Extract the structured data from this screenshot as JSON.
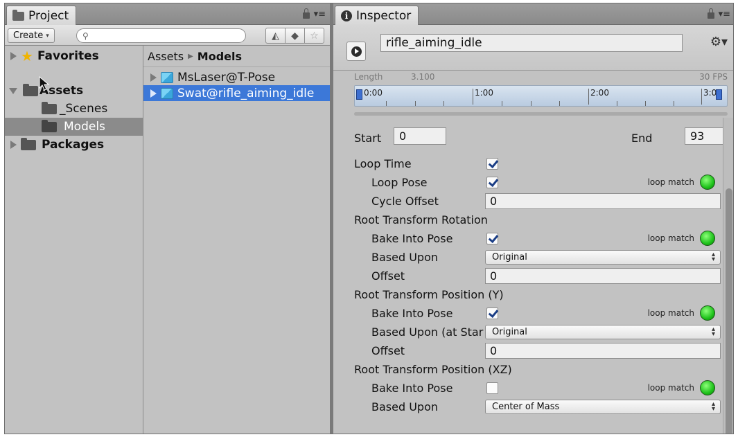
{
  "project": {
    "tab_title": "Project",
    "tab_menu": "▾≡",
    "create_label": "Create",
    "search_placeholder": "",
    "favorites_label": "Favorites",
    "assets_label": "Assets",
    "scenes_label": "_Scenes",
    "models_label": "Models",
    "packages_label": "Packages",
    "breadcrumb_root": "Assets",
    "breadcrumb_current": "Models",
    "items": [
      {
        "label": "MsLaser@T-Pose",
        "selected": false
      },
      {
        "label": "Swat@rifle_aiming_idle",
        "selected": true
      }
    ]
  },
  "inspector": {
    "tab_title": "Inspector",
    "tab_menu": "▾≡",
    "clip_name": "rifle_aiming_idle",
    "length_label": "Length",
    "length_value": "3.100",
    "fps_label": "30 FPS",
    "timeline_labels": [
      "0:00",
      "1:00",
      "2:00",
      "3:0"
    ],
    "start_label": "Start",
    "start_value": "0",
    "end_label": "End",
    "end_value": "93",
    "loop_time_label": "Loop Time",
    "loop_time_checked": true,
    "loop_pose_label": "Loop Pose",
    "loop_pose_checked": true,
    "loop_match_label": "loop match",
    "cycle_offset_label": "Cycle Offset",
    "cycle_offset_value": "0",
    "rot_section": "Root Transform Rotation",
    "rot_bake_label": "Bake Into Pose",
    "rot_bake_checked": true,
    "rot_based_label": "Based Upon",
    "rot_based_value": "Original",
    "rot_offset_label": "Offset",
    "rot_offset_value": "0",
    "posy_section": "Root Transform Position (Y)",
    "posy_bake_label": "Bake Into Pose",
    "posy_bake_checked": true,
    "posy_based_label": "Based Upon (at Star",
    "posy_based_value": "Original",
    "posy_offset_label": "Offset",
    "posy_offset_value": "0",
    "posxz_section": "Root Transform Position (XZ)",
    "posxz_bake_label": "Bake Into Pose",
    "posxz_bake_checked": false,
    "posxz_based_label": "Based Upon",
    "posxz_based_value": "Center of Mass"
  },
  "colors": {
    "panel_bg": "#c2c2c2",
    "selection_blue": "#3c78d8",
    "loop_match_green": "#1fc21b",
    "favorites_star": "#f0b400"
  }
}
